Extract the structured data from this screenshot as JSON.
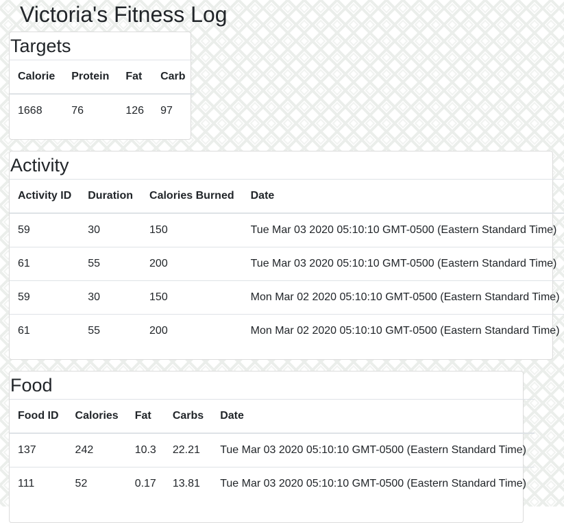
{
  "page": {
    "title": "Victoria's Fitness Log",
    "background_color": "#ffffff",
    "pattern_color": "#ebeeeb"
  },
  "targets": {
    "heading": "Targets",
    "columns": [
      "Calorie",
      "Protein",
      "Fat",
      "Carb"
    ],
    "rows": [
      [
        "1668",
        "76",
        "126",
        "97"
      ]
    ]
  },
  "activity": {
    "heading": "Activity",
    "columns": [
      "Activity ID",
      "Duration",
      "Calories Burned",
      "Date"
    ],
    "rows": [
      [
        "59",
        "30",
        "150",
        "Tue Mar 03 2020 05:10:10 GMT-0500 (Eastern Standard Time)"
      ],
      [
        "61",
        "55",
        "200",
        "Tue Mar 03 2020 05:10:10 GMT-0500 (Eastern Standard Time)"
      ],
      [
        "59",
        "30",
        "150",
        "Mon Mar 02 2020 05:10:10 GMT-0500 (Eastern Standard Time)"
      ],
      [
        "61",
        "55",
        "200",
        "Mon Mar 02 2020 05:10:10 GMT-0500 (Eastern Standard Time)"
      ]
    ]
  },
  "food": {
    "heading": "Food",
    "columns": [
      "Food ID",
      "Calories",
      "Fat",
      "Carbs",
      "Date"
    ],
    "rows": [
      [
        "137",
        "242",
        "10.3",
        "22.21",
        "Tue Mar 03 2020 05:10:10 GMT-0500 (Eastern Standard Time)"
      ],
      [
        "111",
        "52",
        "0.17",
        "13.81",
        "Tue Mar 03 2020 05:10:10 GMT-0500 (Eastern Standard Time)"
      ]
    ]
  }
}
